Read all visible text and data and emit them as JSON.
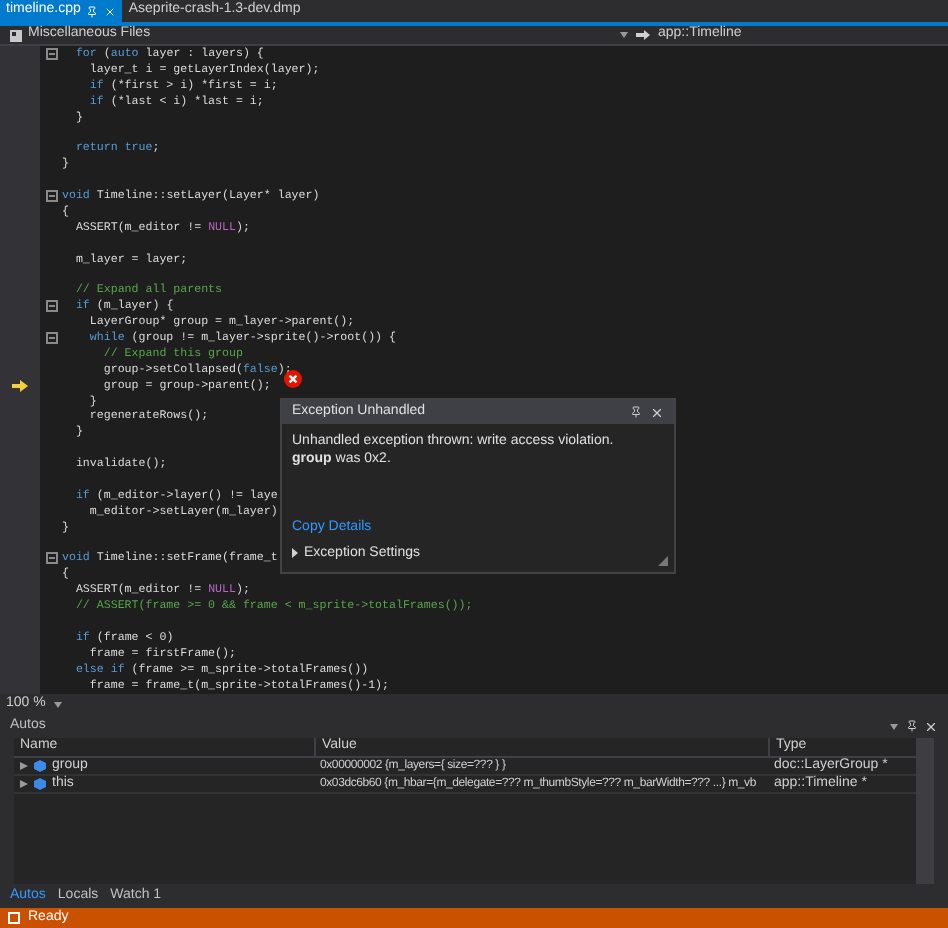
{
  "tabs": [
    {
      "label": "timeline.cpp",
      "selected": true
    },
    {
      "label": "Aseprite-crash-1.3-dev.dmp",
      "selected": false
    }
  ],
  "nav": {
    "project": "Miscellaneous Files",
    "scope": "app::Timeline"
  },
  "code": {
    "lines": [
      {
        "kind": "code",
        "fold": true,
        "current": false,
        "segments": [
          {
            "kind": "keyword",
            "text": "  for"
          },
          {
            "kind": "plain",
            "text": " ("
          },
          {
            "kind": "keyword",
            "text": "auto"
          },
          {
            "kind": "plain",
            "text": " layer : layers) {"
          }
        ]
      },
      {
        "kind": "code",
        "fold": false,
        "current": false,
        "segments": [
          {
            "kind": "plain",
            "text": "    layer_t i = getLayerIndex(layer);"
          }
        ]
      },
      {
        "kind": "code",
        "fold": false,
        "current": false,
        "segments": [
          {
            "kind": "keyword",
            "text": "    if"
          },
          {
            "kind": "plain",
            "text": " (*first > i) *first = i;"
          }
        ]
      },
      {
        "kind": "code",
        "fold": false,
        "current": false,
        "segments": [
          {
            "kind": "keyword",
            "text": "    if"
          },
          {
            "kind": "plain",
            "text": " (*last < i) *last = i;"
          }
        ]
      },
      {
        "kind": "code",
        "fold": false,
        "current": false,
        "segments": [
          {
            "kind": "plain",
            "text": "  }"
          }
        ]
      },
      {
        "kind": "blank"
      },
      {
        "kind": "code",
        "fold": false,
        "current": false,
        "segments": [
          {
            "kind": "keyword",
            "text": "  return"
          },
          {
            "kind": "keyword",
            "text": " true"
          },
          {
            "kind": "plain",
            "text": ";"
          }
        ]
      },
      {
        "kind": "code",
        "fold": false,
        "current": false,
        "segments": [
          {
            "kind": "plain",
            "text": "}"
          }
        ]
      },
      {
        "kind": "blank"
      },
      {
        "kind": "code",
        "fold": true,
        "current": false,
        "segments": [
          {
            "kind": "keyword",
            "text": "void"
          },
          {
            "kind": "plain",
            "text": " Timeline::setLayer(Layer* layer)"
          }
        ]
      },
      {
        "kind": "code",
        "fold": false,
        "current": false,
        "segments": [
          {
            "kind": "plain",
            "text": "{"
          }
        ]
      },
      {
        "kind": "code",
        "fold": false,
        "current": false,
        "segments": [
          {
            "kind": "plain",
            "text": "  ASSERT(m_editor != "
          },
          {
            "kind": "macro",
            "text": "NULL"
          },
          {
            "kind": "plain",
            "text": ");"
          }
        ]
      },
      {
        "kind": "blank"
      },
      {
        "kind": "code",
        "fold": false,
        "current": false,
        "segments": [
          {
            "kind": "plain",
            "text": "  m_layer = layer;"
          }
        ]
      },
      {
        "kind": "blank"
      },
      {
        "kind": "code",
        "fold": false,
        "current": false,
        "segments": [
          {
            "kind": "comment",
            "text": "  // Expand all parents"
          }
        ]
      },
      {
        "kind": "code",
        "fold": true,
        "current": false,
        "segments": [
          {
            "kind": "keyword",
            "text": "  if"
          },
          {
            "kind": "plain",
            "text": " (m_layer) {"
          }
        ]
      },
      {
        "kind": "code",
        "fold": false,
        "current": false,
        "segments": [
          {
            "kind": "plain",
            "text": "    LayerGroup* group = m_layer->parent();"
          }
        ]
      },
      {
        "kind": "code",
        "fold": true,
        "current": false,
        "segments": [
          {
            "kind": "keyword",
            "text": "    while"
          },
          {
            "kind": "plain",
            "text": " (group != m_layer->sprite()->root()) {"
          }
        ]
      },
      {
        "kind": "code",
        "fold": false,
        "current": false,
        "segments": [
          {
            "kind": "comment",
            "text": "      // Expand this group"
          }
        ]
      },
      {
        "kind": "code",
        "fold": false,
        "current": false,
        "segments": [
          {
            "kind": "plain",
            "text": "      group->setCollapsed("
          },
          {
            "kind": "keyword",
            "text": "false"
          },
          {
            "kind": "plain",
            "text": ");"
          }
        ]
      },
      {
        "kind": "code",
        "fold": false,
        "current": true,
        "segments": [
          {
            "kind": "plain",
            "text": "      group = group->parent();"
          }
        ]
      },
      {
        "kind": "code",
        "fold": false,
        "current": false,
        "segments": [
          {
            "kind": "plain",
            "text": "    }"
          }
        ]
      },
      {
        "kind": "code",
        "fold": false,
        "current": false,
        "segments": [
          {
            "kind": "plain",
            "text": "    regenerateRows();"
          }
        ]
      },
      {
        "kind": "code",
        "fold": false,
        "current": false,
        "segments": [
          {
            "kind": "plain",
            "text": "  }"
          }
        ]
      },
      {
        "kind": "blank"
      },
      {
        "kind": "code",
        "fold": false,
        "current": false,
        "segments": [
          {
            "kind": "plain",
            "text": "  invalidate();"
          }
        ]
      },
      {
        "kind": "blank"
      },
      {
        "kind": "code",
        "fold": false,
        "current": false,
        "segments": [
          {
            "kind": "keyword",
            "text": "  if"
          },
          {
            "kind": "plain",
            "text": " (m_editor->layer() != laye"
          }
        ]
      },
      {
        "kind": "code",
        "fold": false,
        "current": false,
        "segments": [
          {
            "kind": "plain",
            "text": "    m_editor->setLayer(m_layer)"
          }
        ]
      },
      {
        "kind": "code",
        "fold": false,
        "current": false,
        "segments": [
          {
            "kind": "plain",
            "text": "}"
          }
        ]
      },
      {
        "kind": "blank"
      },
      {
        "kind": "code",
        "fold": true,
        "current": false,
        "segments": [
          {
            "kind": "keyword",
            "text": "void"
          },
          {
            "kind": "plain",
            "text": " Timeline::setFrame(frame_t"
          }
        ]
      },
      {
        "kind": "code",
        "fold": false,
        "current": false,
        "segments": [
          {
            "kind": "plain",
            "text": "{"
          }
        ]
      },
      {
        "kind": "code",
        "fold": false,
        "current": false,
        "segments": [
          {
            "kind": "plain",
            "text": "  ASSERT(m_editor != "
          },
          {
            "kind": "macro",
            "text": "NULL"
          },
          {
            "kind": "plain",
            "text": ");"
          }
        ]
      },
      {
        "kind": "code",
        "fold": false,
        "current": false,
        "segments": [
          {
            "kind": "comment",
            "text": "  // ASSERT(frame >= 0 && frame < m_sprite->totalFrames());"
          }
        ]
      },
      {
        "kind": "blank"
      },
      {
        "kind": "code",
        "fold": false,
        "current": false,
        "segments": [
          {
            "kind": "keyword",
            "text": "  if"
          },
          {
            "kind": "plain",
            "text": " (frame < 0)"
          }
        ]
      },
      {
        "kind": "code",
        "fold": false,
        "current": false,
        "segments": [
          {
            "kind": "plain",
            "text": "    frame = firstFrame();"
          }
        ]
      },
      {
        "kind": "code",
        "fold": false,
        "current": false,
        "segments": [
          {
            "kind": "keyword",
            "text": "  else"
          },
          {
            "kind": "keyword",
            "text": " if"
          },
          {
            "kind": "plain",
            "text": " (frame >= m_sprite->totalFrames())"
          }
        ]
      },
      {
        "kind": "code",
        "fold": false,
        "current": false,
        "segments": [
          {
            "kind": "plain",
            "text": "    frame = frame_t(m_sprite->totalFrames()-1);"
          }
        ]
      }
    ]
  },
  "exception": {
    "title": "Exception Unhandled",
    "message": "Unhandled exception thrown: write access violation.",
    "detail": "**group** was 0x2.",
    "link": "Copy Details",
    "settings": "Exception Settings"
  },
  "zoom": "100 %",
  "autos": {
    "title": "Autos",
    "columns": [
      "Name",
      "Value",
      "Type"
    ],
    "rows": [
      {
        "name": "group",
        "value": "0x00000002 {m_layers={ size=??? } }",
        "type": "doc::LayerGroup *",
        "expanded": false
      },
      {
        "name": "this",
        "value": "0x03dc6b60 {m_hbar={m_delegate=??? m_thumbStyle=??? m_barWidth=??? ...} m_vb",
        "type": "app::Timeline *",
        "expanded": false
      }
    ]
  },
  "bottom_tabs": [
    {
      "label": "Autos",
      "selected": true
    },
    {
      "label": "Locals",
      "selected": false
    },
    {
      "label": "Watch 1",
      "selected": false
    }
  ],
  "status": "Ready"
}
